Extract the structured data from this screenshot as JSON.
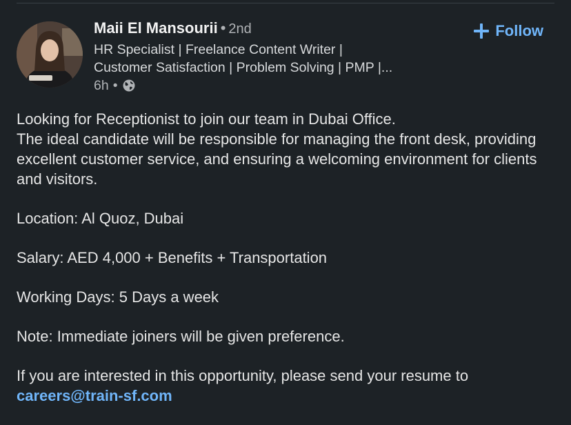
{
  "author": {
    "name": "Maii El Mansourii",
    "separator": "•",
    "degree": "2nd",
    "headline_line1": "HR Specialist | Freelance Content Writer |",
    "headline_line2": "Customer Satisfaction | Problem Solving | PMP |...",
    "time": "6h",
    "meta_separator": "•",
    "visibility_icon": "globe-icon"
  },
  "follow": {
    "label": "Follow",
    "icon": "plus-icon",
    "color": "#70b5f9"
  },
  "post": {
    "intro_line1": "Looking for Receptionist to join our team in Dubai Office.",
    "intro_line2": "The ideal candidate will be responsible for managing the front desk, providing excellent customer service, and ensuring a welcoming environment for clients and visitors.",
    "location": "Location: Al Quoz, Dubai",
    "salary": "Salary: AED 4,000 + Benefits + Transportation",
    "working_days": "Working Days: 5 Days a week",
    "note": "Note: Immediate joiners will be given preference.",
    "cta": "If you are interested in this opportunity, please send your resume to",
    "email": "careers@train-sf.com"
  },
  "colors": {
    "background": "#1d2226",
    "link": "#70b5f9",
    "text": "#e6e6e6"
  }
}
